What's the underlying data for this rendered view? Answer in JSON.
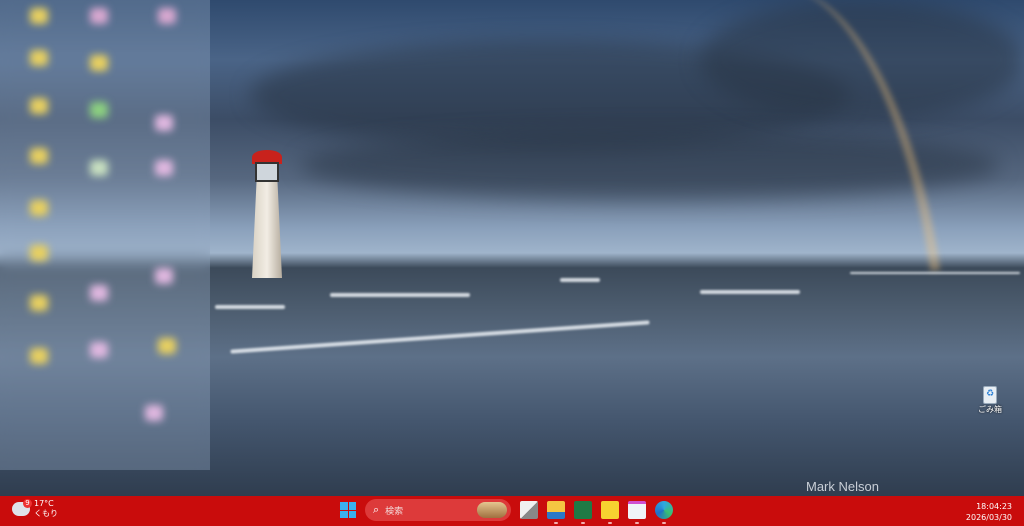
{
  "desktop": {
    "wallpaper": "lighthouse-rainbow-beach",
    "author_credit": "Mark Nelson",
    "icons": [
      {
        "label": "ごみ箱",
        "icon": "recycle-bin-icon"
      }
    ]
  },
  "taskbar": {
    "color": "#c90c0c",
    "weather": {
      "badge": "9",
      "temperature": "17°C",
      "condition": "くもり"
    },
    "search_placeholder": "検索",
    "apps": [
      {
        "name": "task-view",
        "icon": "task-view-icon"
      },
      {
        "name": "file-explorer",
        "icon": "folder-icon"
      },
      {
        "name": "excel",
        "icon": "excel-icon"
      },
      {
        "name": "sticky-notes",
        "icon": "sticky-notes-icon"
      },
      {
        "name": "notepad",
        "icon": "notepad-icon"
      },
      {
        "name": "edge",
        "icon": "edge-icon"
      }
    ],
    "clock": {
      "time": "18:04:23",
      "date": "2026/03/30"
    }
  }
}
